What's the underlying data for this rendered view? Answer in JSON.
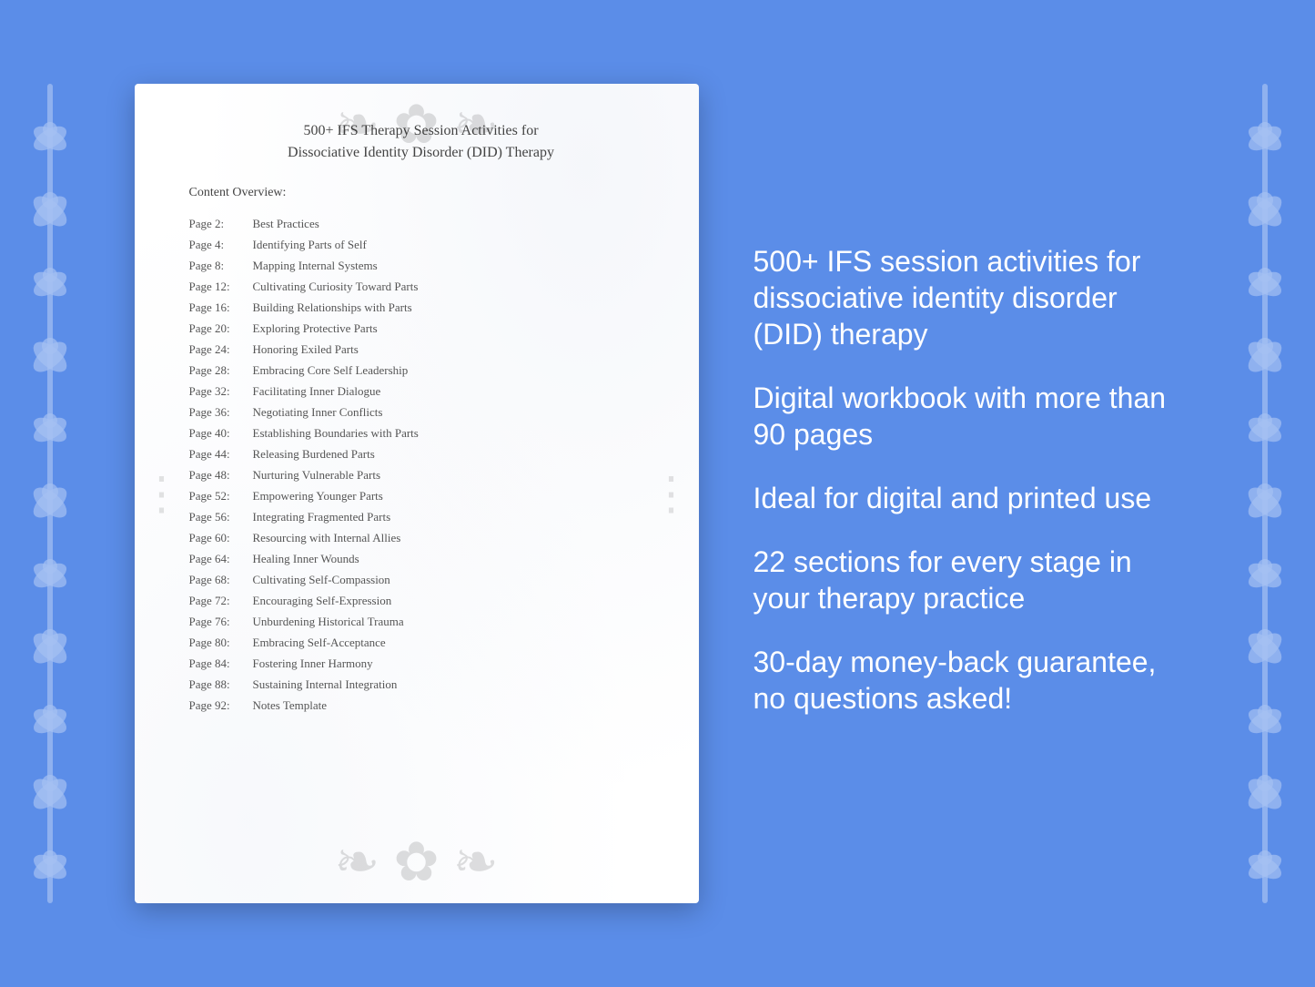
{
  "page": {
    "background_color": "#5b8de8"
  },
  "book": {
    "title_line1": "500+ IFS Therapy Session Activities for",
    "title_line2": "Dissociative Identity Disorder (DID) Therapy",
    "content_overview_label": "Content Overview:",
    "toc": [
      {
        "page": "Page  2:",
        "title": "Best Practices"
      },
      {
        "page": "Page  4:",
        "title": "Identifying Parts of Self"
      },
      {
        "page": "Page  8:",
        "title": "Mapping Internal Systems"
      },
      {
        "page": "Page 12:",
        "title": "Cultivating Curiosity Toward Parts"
      },
      {
        "page": "Page 16:",
        "title": "Building Relationships with Parts"
      },
      {
        "page": "Page 20:",
        "title": "Exploring Protective Parts"
      },
      {
        "page": "Page 24:",
        "title": "Honoring Exiled Parts"
      },
      {
        "page": "Page 28:",
        "title": "Embracing Core Self Leadership"
      },
      {
        "page": "Page 32:",
        "title": "Facilitating Inner Dialogue"
      },
      {
        "page": "Page 36:",
        "title": "Negotiating Inner Conflicts"
      },
      {
        "page": "Page 40:",
        "title": "Establishing Boundaries with Parts"
      },
      {
        "page": "Page 44:",
        "title": "Releasing Burdened Parts"
      },
      {
        "page": "Page 48:",
        "title": "Nurturing Vulnerable Parts"
      },
      {
        "page": "Page 52:",
        "title": "Empowering Younger Parts"
      },
      {
        "page": "Page 56:",
        "title": "Integrating Fragmented Parts"
      },
      {
        "page": "Page 60:",
        "title": "Resourcing with Internal Allies"
      },
      {
        "page": "Page 64:",
        "title": "Healing Inner Wounds"
      },
      {
        "page": "Page 68:",
        "title": "Cultivating Self-Compassion"
      },
      {
        "page": "Page 72:",
        "title": "Encouraging Self-Expression"
      },
      {
        "page": "Page 76:",
        "title": "Unburdening Historical Trauma"
      },
      {
        "page": "Page 80:",
        "title": "Embracing Self-Acceptance"
      },
      {
        "page": "Page 84:",
        "title": "Fostering Inner Harmony"
      },
      {
        "page": "Page 88:",
        "title": "Sustaining Internal Integration"
      },
      {
        "page": "Page 92:",
        "title": "Notes Template"
      }
    ]
  },
  "right_panel": {
    "points": [
      "500+ IFS session activities for dissociative identity disorder (DID) therapy",
      "Digital workbook with more than 90 pages",
      "Ideal for digital and printed use",
      "22 sections for every stage in your therapy practice",
      "30-day money-back guarantee, no questions asked!"
    ]
  }
}
